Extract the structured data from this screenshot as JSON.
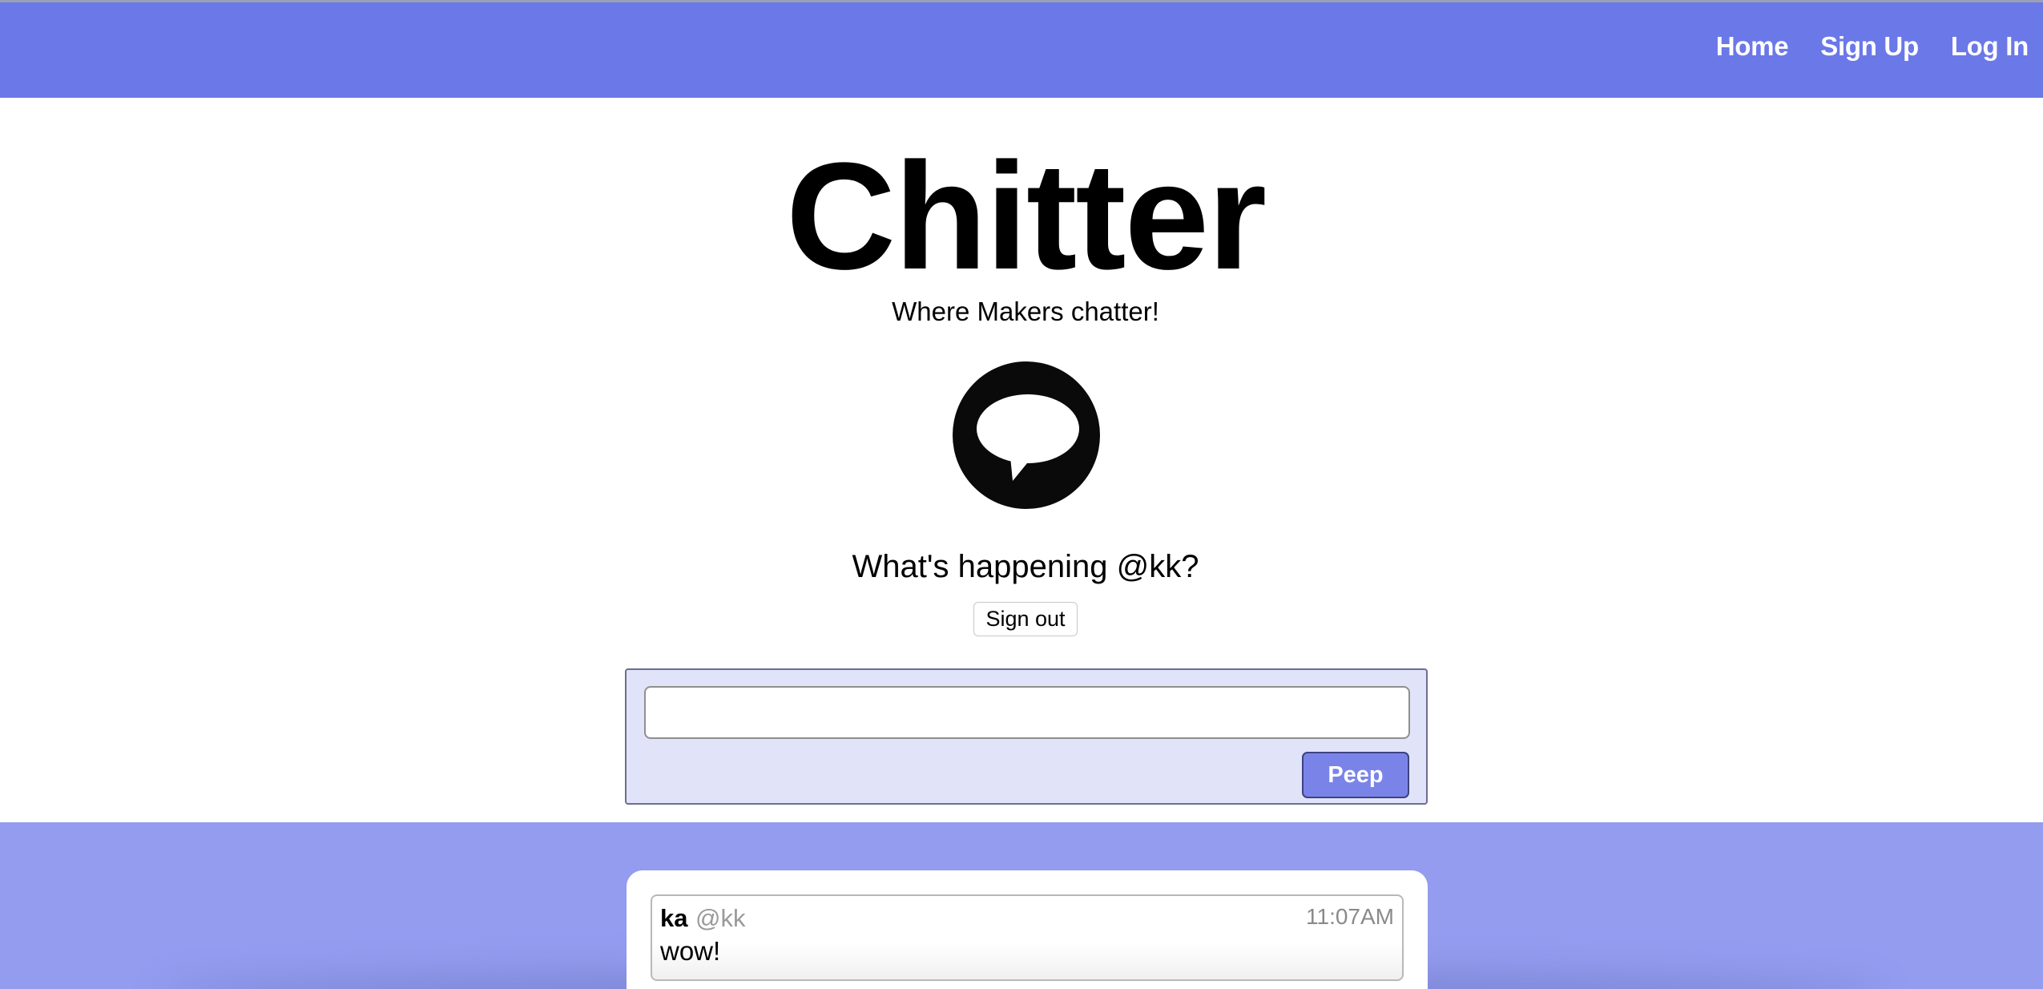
{
  "nav": {
    "links": [
      "Home",
      "Sign Up",
      "Log In"
    ]
  },
  "header": {
    "title": "Chitter",
    "subtitle": "Where Makers chatter!",
    "logo_icon": "speech-bubble-icon"
  },
  "greeting": "What's happening @kk?",
  "signout_label": "Sign out",
  "compose": {
    "input_value": "",
    "button_label": "Peep"
  },
  "peeps": [
    {
      "name": "ka",
      "handle": "@kk",
      "time": "11:07AM",
      "text": "wow!"
    }
  ],
  "colors": {
    "nav_background": "#6b78e8",
    "compose_background": "#e1e3f9",
    "peep_button": "#7a84e8",
    "feed_background": "#939cef"
  }
}
